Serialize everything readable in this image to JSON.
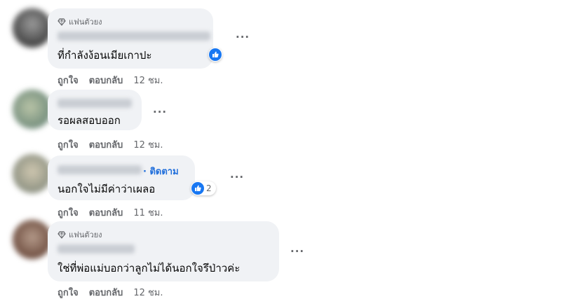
{
  "comments": [
    {
      "badge": "แฟนตัวยง",
      "follow": "",
      "text": "ที่กำลังง้อนเมียเกาปะ",
      "reaction_count": "",
      "like": "ถูกใจ",
      "reply": "ตอบกลับ",
      "time": "12 ชม."
    },
    {
      "badge": "",
      "follow": "",
      "text": "รอผลสอบออก",
      "reaction_count": "",
      "like": "ถูกใจ",
      "reply": "ตอบกลับ",
      "time": "12 ชม."
    },
    {
      "badge": "",
      "follow": "· ติดตาม",
      "text": "นอกใจไม่มีค่าว่าเผลอ",
      "reaction_count": "2",
      "like": "ถูกใจ",
      "reply": "ตอบกลับ",
      "time": "11 ชม."
    },
    {
      "badge": "แฟนตัวยง",
      "follow": "",
      "text": "ใช่ที่พ่อแม่บอกว่าลูกไม่ได้นอกใจรึป่าวค่ะ",
      "reaction_count": "",
      "like": "ถูกใจ",
      "reply": "ตอบกลับ",
      "time": "12 ชม."
    }
  ],
  "more_label": "···",
  "colors": {
    "bubble": "#f0f2f5",
    "secondary_text": "#65676b",
    "link_blue": "#216fdb",
    "like_blue": "#1877f2"
  },
  "icons": {
    "badge": "diamond-icon",
    "reaction": "like-reaction-icon",
    "more": "more-options-icon"
  }
}
